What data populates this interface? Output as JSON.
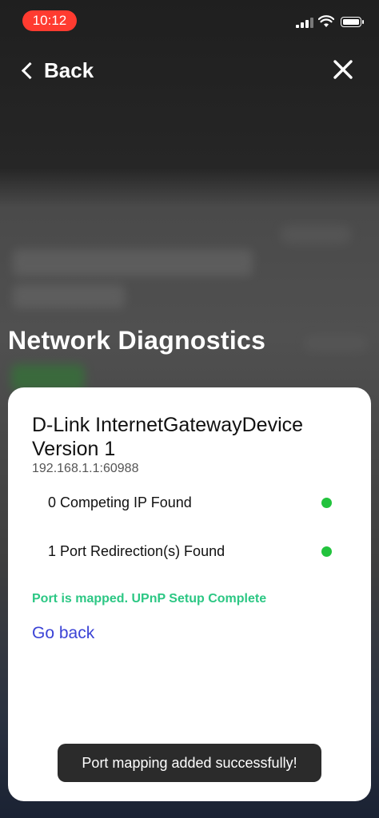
{
  "status_bar": {
    "time": "10:12"
  },
  "nav": {
    "back_label": "Back"
  },
  "page": {
    "title": "Network Diagnostics"
  },
  "card": {
    "device_name": "D-Link InternetGatewayDevice Version 1",
    "device_ip": "192.168.1.1:60988",
    "checks": [
      {
        "label": "0 Competing IP Found",
        "status_color": "#22c33d"
      },
      {
        "label": "1 Port Redirection(s) Found",
        "status_color": "#22c33d"
      }
    ],
    "status_message": "Port is mapped. UPnP Setup Complete",
    "status_color": "#2cc784",
    "go_back_label": "Go back",
    "link_color": "#3b43d6"
  },
  "toast": {
    "message": "Port mapping added successfully!"
  },
  "colors": {
    "time_pill": "#ff3b30"
  },
  "icons": {
    "back": "chevron-left-icon",
    "close": "close-icon",
    "wifi": "wifi-icon",
    "battery": "battery-icon",
    "signal": "signal-icon"
  }
}
